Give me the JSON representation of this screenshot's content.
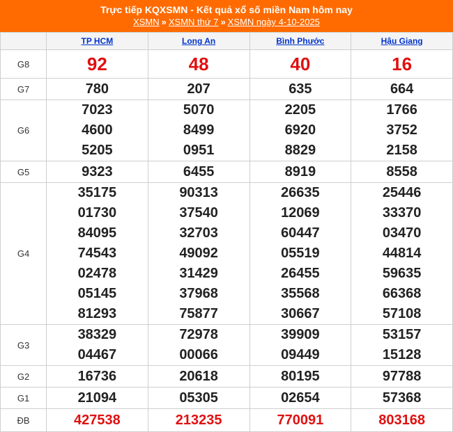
{
  "header": {
    "title": "Trực tiếp KQXSMN - Kết quả xổ số miền Nam hôm nay",
    "crumbs": [
      "XSMN",
      "XSMN thứ 7",
      "XSMN ngày 4-10-2025"
    ],
    "sep": "»"
  },
  "colors": {
    "header_bg": "#ff6b00",
    "highlight": "#e01010",
    "link": "#0033cc"
  },
  "provinces": [
    "TP HCM",
    "Long An",
    "Bình Phước",
    "Hậu Giang"
  ],
  "prizes": [
    {
      "label": "G8",
      "values": [
        [
          "92"
        ],
        [
          "48"
        ],
        [
          "40"
        ],
        [
          "16"
        ]
      ]
    },
    {
      "label": "G7",
      "values": [
        [
          "780"
        ],
        [
          "207"
        ],
        [
          "635"
        ],
        [
          "664"
        ]
      ]
    },
    {
      "label": "G6",
      "values": [
        [
          "7023",
          "4600",
          "5205"
        ],
        [
          "5070",
          "8499",
          "0951"
        ],
        [
          "2205",
          "6920",
          "8829"
        ],
        [
          "1766",
          "3752",
          "2158"
        ]
      ]
    },
    {
      "label": "G5",
      "values": [
        [
          "9323"
        ],
        [
          "6455"
        ],
        [
          "8919"
        ],
        [
          "8558"
        ]
      ]
    },
    {
      "label": "G4",
      "values": [
        [
          "35175",
          "01730",
          "84095",
          "74543",
          "02478",
          "05145",
          "81293"
        ],
        [
          "90313",
          "37540",
          "32703",
          "49092",
          "31429",
          "37968",
          "75877"
        ],
        [
          "26635",
          "12069",
          "60447",
          "05519",
          "26455",
          "35568",
          "30667"
        ],
        [
          "25446",
          "33370",
          "03470",
          "44814",
          "59635",
          "66368",
          "57108"
        ]
      ]
    },
    {
      "label": "G3",
      "values": [
        [
          "38329",
          "04467"
        ],
        [
          "72978",
          "00066"
        ],
        [
          "39909",
          "09449"
        ],
        [
          "53157",
          "15128"
        ]
      ]
    },
    {
      "label": "G2",
      "values": [
        [
          "16736"
        ],
        [
          "20618"
        ],
        [
          "80195"
        ],
        [
          "97788"
        ]
      ]
    },
    {
      "label": "G1",
      "values": [
        [
          "21094"
        ],
        [
          "05305"
        ],
        [
          "02654"
        ],
        [
          "57368"
        ]
      ]
    },
    {
      "label": "ĐB",
      "values": [
        [
          "427538"
        ],
        [
          "213235"
        ],
        [
          "770091"
        ],
        [
          "803168"
        ]
      ]
    }
  ]
}
